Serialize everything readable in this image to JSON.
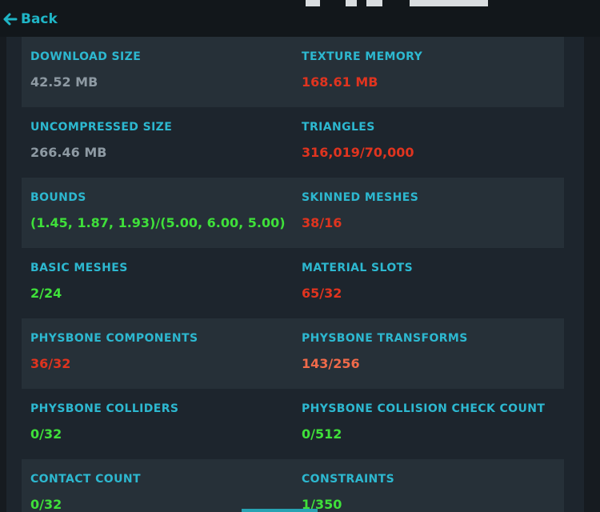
{
  "nav": {
    "back_label": "Back"
  },
  "stats": [
    {
      "left": {
        "label": "DOWNLOAD SIZE",
        "value": "42.52 MB",
        "color": "#8e9aa3"
      },
      "right": {
        "label": "TEXTURE MEMORY",
        "value": "168.61 MB",
        "color": "#e0341f"
      }
    },
    {
      "left": {
        "label": "UNCOMPRESSED SIZE",
        "value": "266.46 MB",
        "color": "#8e9aa3"
      },
      "right": {
        "label": "TRIANGLES",
        "value": "316,019/70,000",
        "color": "#e0341f"
      }
    },
    {
      "left": {
        "label": "BOUNDS",
        "value": "(1.45, 1.87, 1.93)/(5.00, 6.00, 5.00)",
        "color": "#3fe03a"
      },
      "right": {
        "label": "SKINNED MESHES",
        "value": "38/16",
        "color": "#e0341f"
      }
    },
    {
      "left": {
        "label": "BASIC MESHES",
        "value": "2/24",
        "color": "#3fe03a"
      },
      "right": {
        "label": "MATERIAL SLOTS",
        "value": "65/32",
        "color": "#e0341f"
      }
    },
    {
      "left": {
        "label": "PHYSBONE COMPONENTS",
        "value": "36/32",
        "color": "#e0341f"
      },
      "right": {
        "label": "PHYSBONE TRANSFORMS",
        "value": "143/256",
        "color": "#f06a4a"
      }
    },
    {
      "left": {
        "label": "PHYSBONE COLLIDERS",
        "value": "0/32",
        "color": "#3fe03a"
      },
      "right": {
        "label": "PHYSBONE COLLISION CHECK COUNT",
        "value": "0/512",
        "color": "#3fe03a"
      }
    },
    {
      "left": {
        "label": "CONTACT COUNT",
        "value": "0/32",
        "color": "#3fe03a"
      },
      "right": {
        "label": "CONSTRAINTS",
        "value": "1/350",
        "color": "#3fe03a"
      }
    }
  ]
}
